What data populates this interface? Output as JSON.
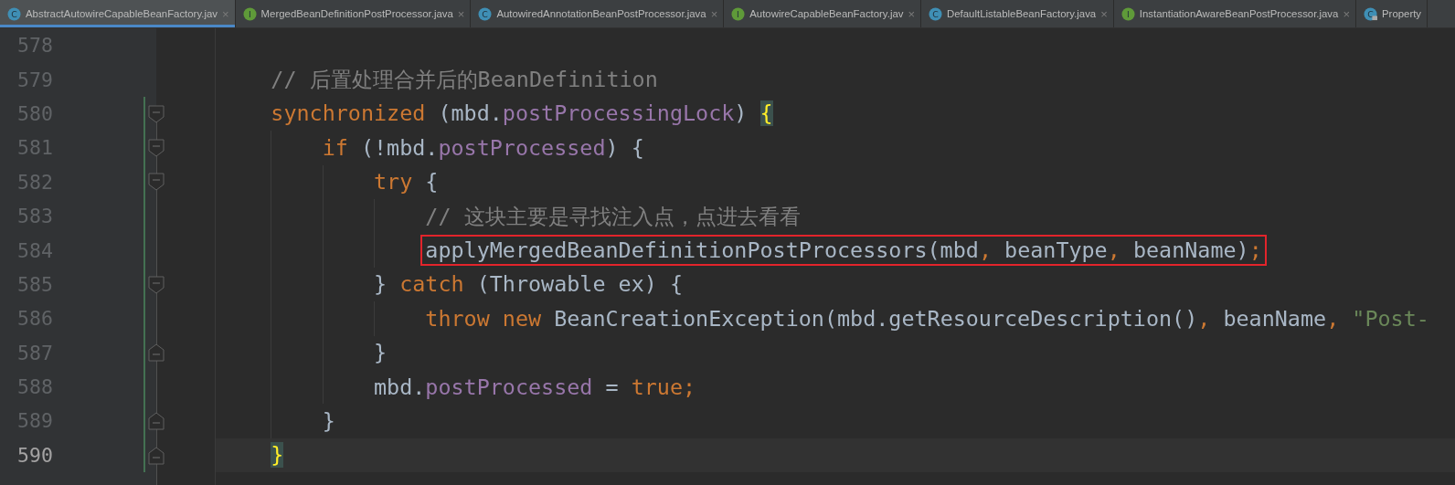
{
  "tabs": [
    {
      "label": "AbstractAutowireCapableBeanFactory.jav",
      "kind": "class",
      "letter": "C",
      "close": "×",
      "selected": true
    },
    {
      "label": "MergedBeanDefinitionPostProcessor.java",
      "kind": "interface",
      "letter": "I",
      "close": "×",
      "selected": false
    },
    {
      "label": "AutowiredAnnotationBeanPostProcessor.java",
      "kind": "class",
      "letter": "C",
      "close": "×",
      "selected": false
    },
    {
      "label": "AutowireCapableBeanFactory.jav",
      "kind": "interface",
      "letter": "I",
      "close": "×",
      "selected": false
    },
    {
      "label": "DefaultListableBeanFactory.java",
      "kind": "class",
      "letter": "C",
      "close": "×",
      "selected": false
    },
    {
      "label": "InstantiationAwareBeanPostProcessor.java",
      "kind": "interface",
      "letter": "I",
      "close": "×",
      "selected": false
    },
    {
      "label": "Property",
      "kind": "locked-class",
      "letter": "C",
      "selected": false
    }
  ],
  "lines": [
    {
      "number": "578",
      "fold_start": false,
      "fold_end": false,
      "changed": false,
      "current": false
    },
    {
      "number": "579",
      "fold_start": false,
      "fold_end": false,
      "changed": false,
      "current": false,
      "boxed": false,
      "tokens": [
        {
          "kind": "comment",
          "text": "    // 后置处理合并后的BeanDefinition"
        }
      ]
    },
    {
      "number": "580",
      "fold_start": true,
      "fold_end": false,
      "changed": true,
      "current": false,
      "boxed": false,
      "tokens": [
        {
          "kind": "keyword",
          "text": "    synchronized "
        },
        {
          "kind": "plain",
          "text": "(mbd."
        },
        {
          "kind": "field",
          "text": "postProcessingLock"
        },
        {
          "kind": "plain",
          "text": ") "
        },
        {
          "kind": "brace-match",
          "text": "{"
        }
      ]
    },
    {
      "number": "581",
      "fold_start": true,
      "fold_end": false,
      "changed": true,
      "current": false,
      "boxed": false,
      "tokens": [
        {
          "kind": "keyword",
          "text": "        if "
        },
        {
          "kind": "plain",
          "text": "(!mbd."
        },
        {
          "kind": "field",
          "text": "postProcessed"
        },
        {
          "kind": "plain",
          "text": ") {"
        }
      ]
    },
    {
      "number": "582",
      "fold_start": true,
      "fold_end": false,
      "changed": true,
      "current": false,
      "boxed": false,
      "tokens": [
        {
          "kind": "keyword",
          "text": "            try "
        },
        {
          "kind": "plain",
          "text": "{"
        }
      ]
    },
    {
      "number": "583",
      "fold_start": false,
      "fold_end": false,
      "changed": true,
      "current": false,
      "boxed": false,
      "tokens": [
        {
          "kind": "comment",
          "text": "                // 这块主要是寻找注入点，点进去看看"
        }
      ]
    },
    {
      "number": "584",
      "fold_start": false,
      "fold_end": false,
      "changed": true,
      "current": false,
      "boxed": true,
      "tokens": [
        {
          "kind": "plain",
          "text": "                applyMergedBeanDefinitionPostProcessors(mbd"
        },
        {
          "kind": "keyword",
          "text": ", "
        },
        {
          "kind": "plain",
          "text": "beanType"
        },
        {
          "kind": "keyword",
          "text": ", "
        },
        {
          "kind": "plain",
          "text": "beanName)"
        },
        {
          "kind": "keyword",
          "text": ";"
        }
      ]
    },
    {
      "number": "585",
      "fold_start": true,
      "fold_end": false,
      "changed": true,
      "current": false,
      "boxed": false,
      "tokens": [
        {
          "kind": "plain",
          "text": "            } "
        },
        {
          "kind": "keyword",
          "text": "catch "
        },
        {
          "kind": "plain",
          "text": "(Throwable ex) {"
        }
      ]
    },
    {
      "number": "586",
      "fold_start": false,
      "fold_end": false,
      "changed": true,
      "current": false,
      "boxed": false,
      "tokens": [
        {
          "kind": "keyword",
          "text": "                throw new "
        },
        {
          "kind": "plain",
          "text": "BeanCreationException(mbd.getResourceDescription()"
        },
        {
          "kind": "keyword",
          "text": ", "
        },
        {
          "kind": "plain",
          "text": "beanName"
        },
        {
          "kind": "keyword",
          "text": ", "
        },
        {
          "kind": "string",
          "text": "\"Post-"
        }
      ]
    },
    {
      "number": "587",
      "fold_start": false,
      "fold_end": true,
      "changed": true,
      "current": false,
      "boxed": false,
      "tokens": [
        {
          "kind": "plain",
          "text": "            }"
        }
      ]
    },
    {
      "number": "588",
      "fold_start": false,
      "fold_end": false,
      "changed": true,
      "current": false,
      "boxed": false,
      "tokens": [
        {
          "kind": "plain",
          "text": "            mbd."
        },
        {
          "kind": "field",
          "text": "postProcessed"
        },
        {
          "kind": "plain",
          "text": " = "
        },
        {
          "kind": "keyword",
          "text": "true"
        },
        {
          "kind": "keyword",
          "text": ";"
        }
      ]
    },
    {
      "number": "589",
      "fold_start": false,
      "fold_end": true,
      "changed": true,
      "current": false,
      "boxed": false,
      "tokens": [
        {
          "kind": "plain",
          "text": "        }"
        }
      ]
    },
    {
      "number": "590",
      "fold_start": false,
      "fold_end": true,
      "changed": true,
      "current": true,
      "boxed": false,
      "tokens": [
        {
          "kind": "brace-match",
          "text": "    }"
        }
      ]
    }
  ]
}
